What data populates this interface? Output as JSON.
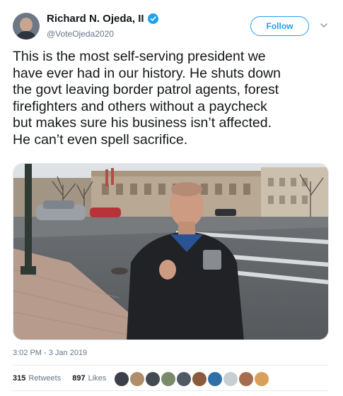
{
  "author": {
    "name": "Richard N. Ojeda, II",
    "handle": "@VoteOjeda2020"
  },
  "follow_label": "Follow",
  "tweet_text": "This is the most self-serving president we\nhave ever had in our history. He shuts down\nthe govt leaving border patrol agents, forest\nfirefighters and others without a paycheck\nbut makes sure his business isn’t affected.\nHe can’t even spell sacrifice.",
  "timestamp": "3:02 PM - 3 Jan 2019",
  "stats": {
    "retweets_count": "315",
    "retweets_label": "Retweets",
    "likes_count": "897",
    "likes_label": "Likes"
  },
  "colors": {
    "accent": "#1da1f2",
    "secondary_text": "#657786"
  },
  "likers": [
    "#3b3f47",
    "#b08d6a",
    "#444a52",
    "#7a8a6b",
    "#4f5a66",
    "#8c5a3c",
    "#2f6fa8",
    "#c9ced3",
    "#a56d4f",
    "#d9a05b"
  ]
}
